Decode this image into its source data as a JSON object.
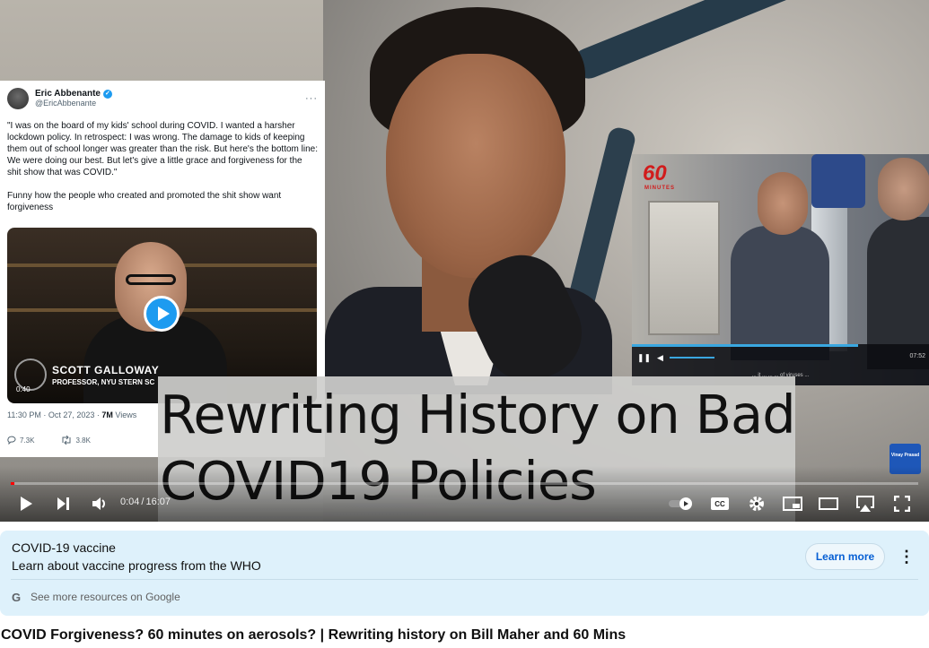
{
  "player": {
    "overlay_title_line1": "Rewriting History on Bad",
    "overlay_title_line2": "COVID19 Policies",
    "current_time": "0:04",
    "time_separator": "/",
    "duration": "16:07",
    "progress": 0.004,
    "channel_badge": "Vinay Prasad"
  },
  "tweet": {
    "name": "Eric Abbenante",
    "handle": "@EricAbbenante",
    "more": "···",
    "quote": "\"I was on the board of my kids' school during COVID. I wanted a harsher lockdown policy. In retrospect: I was wrong. The damage to kids of keeping them out of school longer was greater than the risk. But here's the bottom line: We were doing our best. But let's give a little grace and forgiveness for the shit show that was COVID.\"",
    "comment": "Funny how the people who created and promoted the shit show want forgiveness",
    "media_name": "SCOTT GALLOWAY",
    "media_role": "PROFESSOR, NYU STERN SC",
    "media_duration": "0:40",
    "date": "11:30 PM · Oct 27, 2023 · ",
    "views_count": "7M",
    "views_label": " Views",
    "replies": "7.3K",
    "retweets": "3.8K"
  },
  "inset": {
    "logo": "60",
    "logo_sub": "MINUTES",
    "time": "07:52",
    "subtitle": "... it ... ... ... of viruses ..."
  },
  "info_panel": {
    "title": "COVID-19 vaccine",
    "subtitle": "Learn about vaccine progress from the WHO",
    "learn_more": "Learn more",
    "google_link": "See more resources on Google"
  },
  "video": {
    "title": "COVID Forgiveness? 60 minutes on aerosols? | Rewriting history on Bill Maher and 60 Mins"
  },
  "colors": {
    "progress": "#ff0000",
    "info_bg": "#def1fb",
    "link_blue": "#065fd4",
    "twitter_blue": "#1d9bf0",
    "sixty_red": "#d11c1c"
  }
}
